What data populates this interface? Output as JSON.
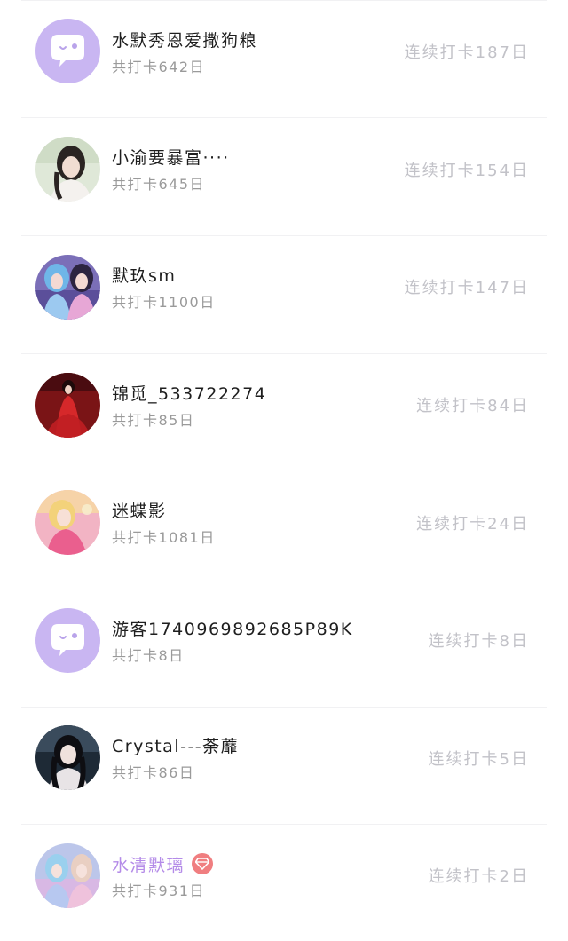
{
  "colors": {
    "accent_purple": "#c9b6f2",
    "vip_name": "#b48be8",
    "vip_badge": "#f07e80",
    "streak_text": "#c2c2c8",
    "total_text": "#9a9a9a"
  },
  "rows": [
    {
      "avatar": "default-chat-bubble-avatar",
      "name": "水默秀恩爱撒狗粮",
      "total": "共打卡642日",
      "streak": "连续打卡187日"
    },
    {
      "avatar": "user-photo-avatar",
      "name": "小渝要暴富····",
      "total": "共打卡645日",
      "streak": "连续打卡154日"
    },
    {
      "avatar": "user-photo-avatar",
      "name": "默玖sm",
      "total": "共打卡1100日",
      "streak": "连续打卡147日"
    },
    {
      "avatar": "user-photo-avatar",
      "name": "锦觅_533722274",
      "total": "共打卡85日",
      "streak": "连续打卡84日"
    },
    {
      "avatar": "user-photo-avatar",
      "name": "迷蝶影",
      "total": "共打卡1081日",
      "streak": "连续打卡24日"
    },
    {
      "avatar": "default-chat-bubble-avatar",
      "name": "游客1740969892685P89K",
      "total": "共打卡8日",
      "streak": "连续打卡8日"
    },
    {
      "avatar": "user-photo-avatar",
      "name": "Crystal---荼蘼",
      "total": "共打卡86日",
      "streak": "连续打卡5日"
    },
    {
      "avatar": "user-photo-avatar",
      "name": "水清默璃",
      "total": "共打卡931日",
      "streak": "连续打卡2日",
      "vip": true,
      "badge_icon": "diamond-icon"
    }
  ]
}
